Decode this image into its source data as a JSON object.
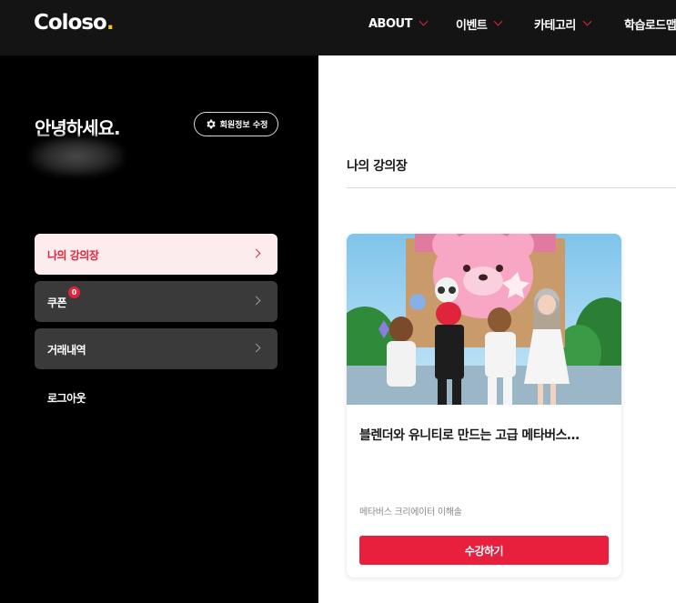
{
  "header": {
    "logo_text": "Coloso",
    "logo_dot": ".",
    "nav": [
      {
        "label": "ABOUT"
      },
      {
        "label": "이벤트"
      },
      {
        "label": "카테고리"
      },
      {
        "label": "학습로드맵"
      }
    ]
  },
  "sidebar": {
    "greeting": "안녕하세요.",
    "edit_profile_label": "회원정보 수정",
    "menu": [
      {
        "label": "나의 강의장",
        "active": true
      },
      {
        "label": "쿠폰",
        "badge": "0"
      },
      {
        "label": "거래내역"
      }
    ],
    "logout_label": "로그아웃"
  },
  "main": {
    "section_title": "나의 강의장",
    "courses": [
      {
        "title": "블렌더와 유니티로 만드는 고급 메타버스…",
        "instructor": "메타버스 크리에이터 이해솔",
        "button_label": "수강하기"
      }
    ]
  },
  "colors": {
    "accent": "#e8203e",
    "sidebar_bg": "#000000",
    "topbar_bg": "#141414",
    "active_menu_bg": "#fdeced"
  }
}
